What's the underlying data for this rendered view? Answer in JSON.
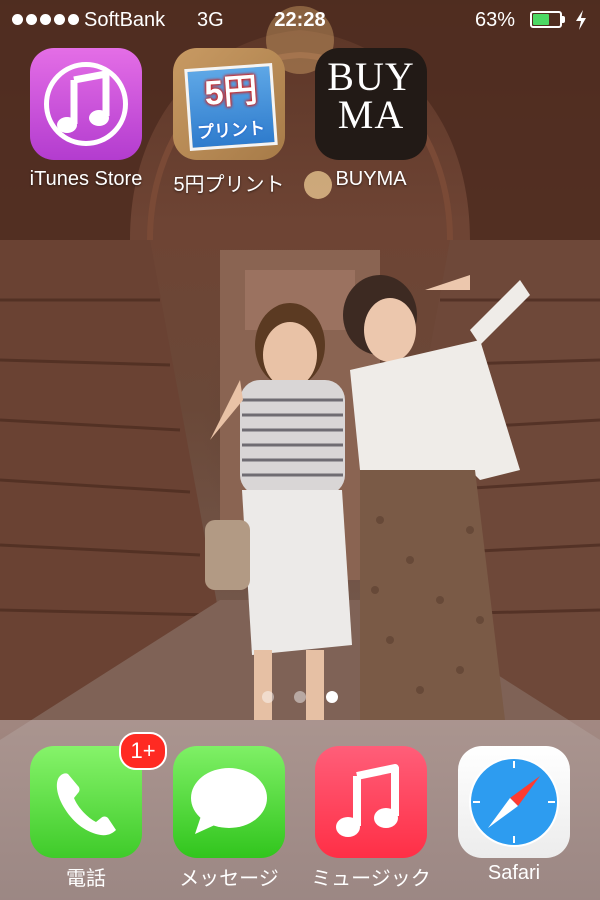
{
  "status_bar": {
    "carrier": "SoftBank",
    "network": "3G",
    "time": "22:28",
    "battery_percent_label": "63%",
    "battery_level": 0.63,
    "signal_icon": "signal-dots-icon",
    "charge_icon": "charging-bolt-icon"
  },
  "home_apps": [
    {
      "label": "iTunes Store",
      "icon": "itunes-store-icon",
      "color": "#c94fd8"
    },
    {
      "label": "5円プリント",
      "icon": "5yen-print-icon",
      "tile_text_main": "5円",
      "tile_text_sub": "プリント"
    },
    {
      "label": "BUYMA",
      "icon": "buyma-icon",
      "tile_text_top": "BUY",
      "tile_text_bottom": "MA"
    }
  ],
  "page_indicator": {
    "pages": 3,
    "current": 3
  },
  "dock": {
    "apps": [
      {
        "label": "電話",
        "icon": "phone-icon",
        "badge": "1+"
      },
      {
        "label": "メッセージ",
        "icon": "messages-icon"
      },
      {
        "label": "ミュージック",
        "icon": "music-icon"
      },
      {
        "label": "Safari",
        "icon": "safari-compass-icon"
      }
    ]
  },
  "colors": {
    "badge": "#ff2a22",
    "phone_green": "#4cd964",
    "music_red": "#ff3b4f"
  }
}
